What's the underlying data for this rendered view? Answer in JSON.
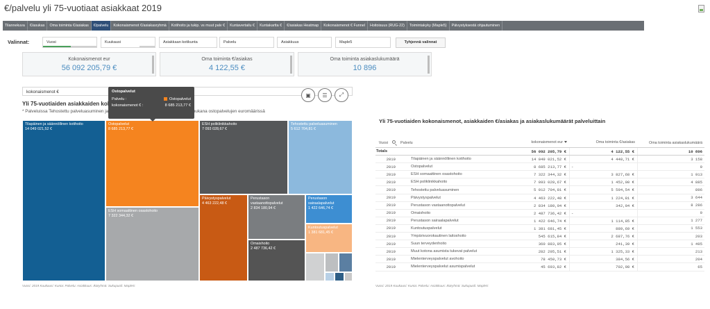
{
  "page": {
    "title": "€/palvelu yli 75-vuotiaat asiakkaat 2019"
  },
  "tabs": [
    {
      "label": "Tilannekuva",
      "active": false
    },
    {
      "label": "€/asukas",
      "active": false
    },
    {
      "label": "Oma toiminta €/asiakas",
      "active": false
    },
    {
      "label": "€/palvelu",
      "active": true
    },
    {
      "label": "Kokonaismenot €/asiakasryhmä",
      "active": false
    },
    {
      "label": "Kotihoito ja tukip. vs muut palv €",
      "active": false
    },
    {
      "label": "Kuntavertailu €",
      "active": false
    },
    {
      "label": "Kuntakartta €",
      "active": false
    },
    {
      "label": "€/asiakas Heatmap",
      "active": false
    },
    {
      "label": "Kokonaismenot € Funnel",
      "active": false
    },
    {
      "label": "Hoitoisuus (RUG-22)",
      "active": false
    },
    {
      "label": "Toimintakyky (Maple5)",
      "active": false
    },
    {
      "label": "Päivystyksestä ohjautuminen",
      "active": false
    }
  ],
  "filters": {
    "label": "Valinnat:",
    "items": [
      "Vuosi",
      "Kuukausi",
      "Asiakkaan kotikunta",
      "Palvelu",
      "Asiakkuus",
      "Maple5"
    ],
    "clear_label": "Tyhjennä valinnat"
  },
  "kpis": [
    {
      "title": "Kokonaismenot eur",
      "value": "56 092 205,79 €"
    },
    {
      "title": "Oma toiminta €/asiakas",
      "value": "4 122,55 €"
    },
    {
      "title": "Oma toiminta asiakaslukumäärä",
      "value": "10 896"
    }
  ],
  "treemap": {
    "measure": "kokonaismenot €",
    "title": "Yli 75-vuotiaiden asiakkaiden kokonaismenot € palveluittain",
    "note": "* Palveluissa Tehostettu palveluasuminen ja Tilapäinen ja säännöllinen kotihoito ei ole mukana ostopalvelujen euromäärissä",
    "footer": "Vuosi: 2019 Kuukausi: Kunta: Palvelu: Asiakkuus: Ikäryhmä: Sukupuoli: Maple5:",
    "cells": [
      {
        "label": "Tilapäinen ja säännöllinen kotihoito",
        "value": "14 049 021,52 €",
        "color": "#135f93"
      },
      {
        "label": "Ostopalvelut",
        "value": "8 685 213,77 €",
        "color": "#f5841f"
      },
      {
        "label": "ESH poliklinikkahoito",
        "value": "7 093 028,67 €",
        "color": "#555759"
      },
      {
        "label": "Tehostettu palveluasuminen",
        "value": "5 612 704,81 €",
        "color": "#8cb9dd"
      },
      {
        "label": "ESH somaattinen osastohoito",
        "value": "7 322 344,32 €",
        "color": "#a7a9ab"
      },
      {
        "label": "Päivystyspalvelut",
        "value": "4 463 222,48 €",
        "color": "#c85a14"
      },
      {
        "label": "Perustason vastaanottopalvelut",
        "value": "2 834 180,94 €",
        "color": "#7a7d80"
      },
      {
        "label": "Perustason sairaalapalvelut",
        "value": "1 422 646,74 €",
        "color": "#3d8ed2"
      },
      {
        "label": "Kuntoutuspalvelut",
        "value": "1 381 681,45 €",
        "color": "#f8b682"
      },
      {
        "label": "Omaishoito",
        "value": "2 487 736,42 €",
        "color": "#545454"
      }
    ],
    "small_colors": [
      "#d0d1d2",
      "#bdbfc1",
      "#5b7fa2",
      "#b8d0e6",
      "#2e5e86",
      "#c9c9c9"
    ]
  },
  "tooltip": {
    "heading": "Ostopalvelut",
    "row1_label": "Palvelu :",
    "row1_value": "Ostopalvelut",
    "row2_label": "kokonaismenot € :",
    "row2_value": "8 685 213,77 €"
  },
  "table": {
    "title": "Yli 75-vuotiaiden kokonaismenot, asiakkaiden €/asiakas ja asiakaslukumäärät palveluittain",
    "footer": "Vuosi: 2019 Kuukausi: Kunta: Palvelu: Asiakkuus: Ikäryhmä: Sukupuoli: Maple5:",
    "headers": [
      "Vuosi",
      "Palvelu",
      "kokonaismenot eur",
      "Oma toiminta €/asiakas",
      "Oma toiminta asiakaslukumäärä"
    ],
    "total": {
      "label": "Totals",
      "kok": "56 092 205,79 €",
      "oma": "4 122,55 €",
      "lkm": "10 896"
    },
    "rows": [
      {
        "year": "2019",
        "palvelu": "Tilapäinen ja säännöllinen kotihoito",
        "kok": "14 049 021,52 €",
        "oma": "4 448,71 €",
        "lkm": "3 158"
      },
      {
        "year": "2019",
        "palvelu": "Ostopalvelut",
        "kok": "8 685 213,77 €",
        "oma": "-",
        "lkm": "0"
      },
      {
        "year": "2019",
        "palvelu": "ESH somaattinen osastohoito",
        "kok": "7 322 344,32 €",
        "oma": "3 827,68 €",
        "lkm": "1 913"
      },
      {
        "year": "2019",
        "palvelu": "ESH poliklinikkahoito",
        "kok": "7 093 028,67 €",
        "oma": "1 452,00 €",
        "lkm": "4 885"
      },
      {
        "year": "2019",
        "palvelu": "Tehostettu palveluasuminen",
        "kok": "5 012 704,81 €",
        "oma": "5 594,54 €",
        "lkm": "896"
      },
      {
        "year": "2019",
        "palvelu": "Päivystyspalvelut",
        "kok": "4 463 222,48 €",
        "oma": "1 224,81 €",
        "lkm": "3 644"
      },
      {
        "year": "2019",
        "palvelu": "Perustason vastaanottopalvelut",
        "kok": "2 834 180,94 €",
        "oma": "342,04 €",
        "lkm": "8 286"
      },
      {
        "year": "2019",
        "palvelu": "Omaishoito",
        "kok": "2 487 736,42 €",
        "oma": "-",
        "lkm": "0"
      },
      {
        "year": "2019",
        "palvelu": "Perustason sairaalapalvelut",
        "kok": "1 422 646,74 €",
        "oma": "1 114,85 €",
        "lkm": "1 277"
      },
      {
        "year": "2019",
        "palvelu": "Kuntoutuspalvelut",
        "kok": "1 381 681,45 €",
        "oma": "889,69 €",
        "lkm": "1 553"
      },
      {
        "year": "2019",
        "palvelu": "Ympärivuorokautinen laitoshoito",
        "kok": "545 615,84 €",
        "oma": "2 687,76 €",
        "lkm": "203"
      },
      {
        "year": "2019",
        "palvelu": "Suun terveydenhoito",
        "kok": "360 883,95 €",
        "oma": "241,39 €",
        "lkm": "1 495"
      },
      {
        "year": "2019",
        "palvelu": "Muut kotona asumista tukevat palvelut",
        "kok": "282 295,51 €",
        "oma": "1 325,33 €",
        "lkm": "213"
      },
      {
        "year": "2019",
        "palvelu": "Mielenterveyspalvelut avohoito",
        "kok": "78 450,73 €",
        "oma": "384,56 €",
        "lkm": "204"
      },
      {
        "year": "2019",
        "palvelu": "Mielenterveyspalvelut asumispalvelut",
        "kok": "45 693,82 €",
        "oma": "702,98 €",
        "lkm": "65"
      }
    ]
  }
}
